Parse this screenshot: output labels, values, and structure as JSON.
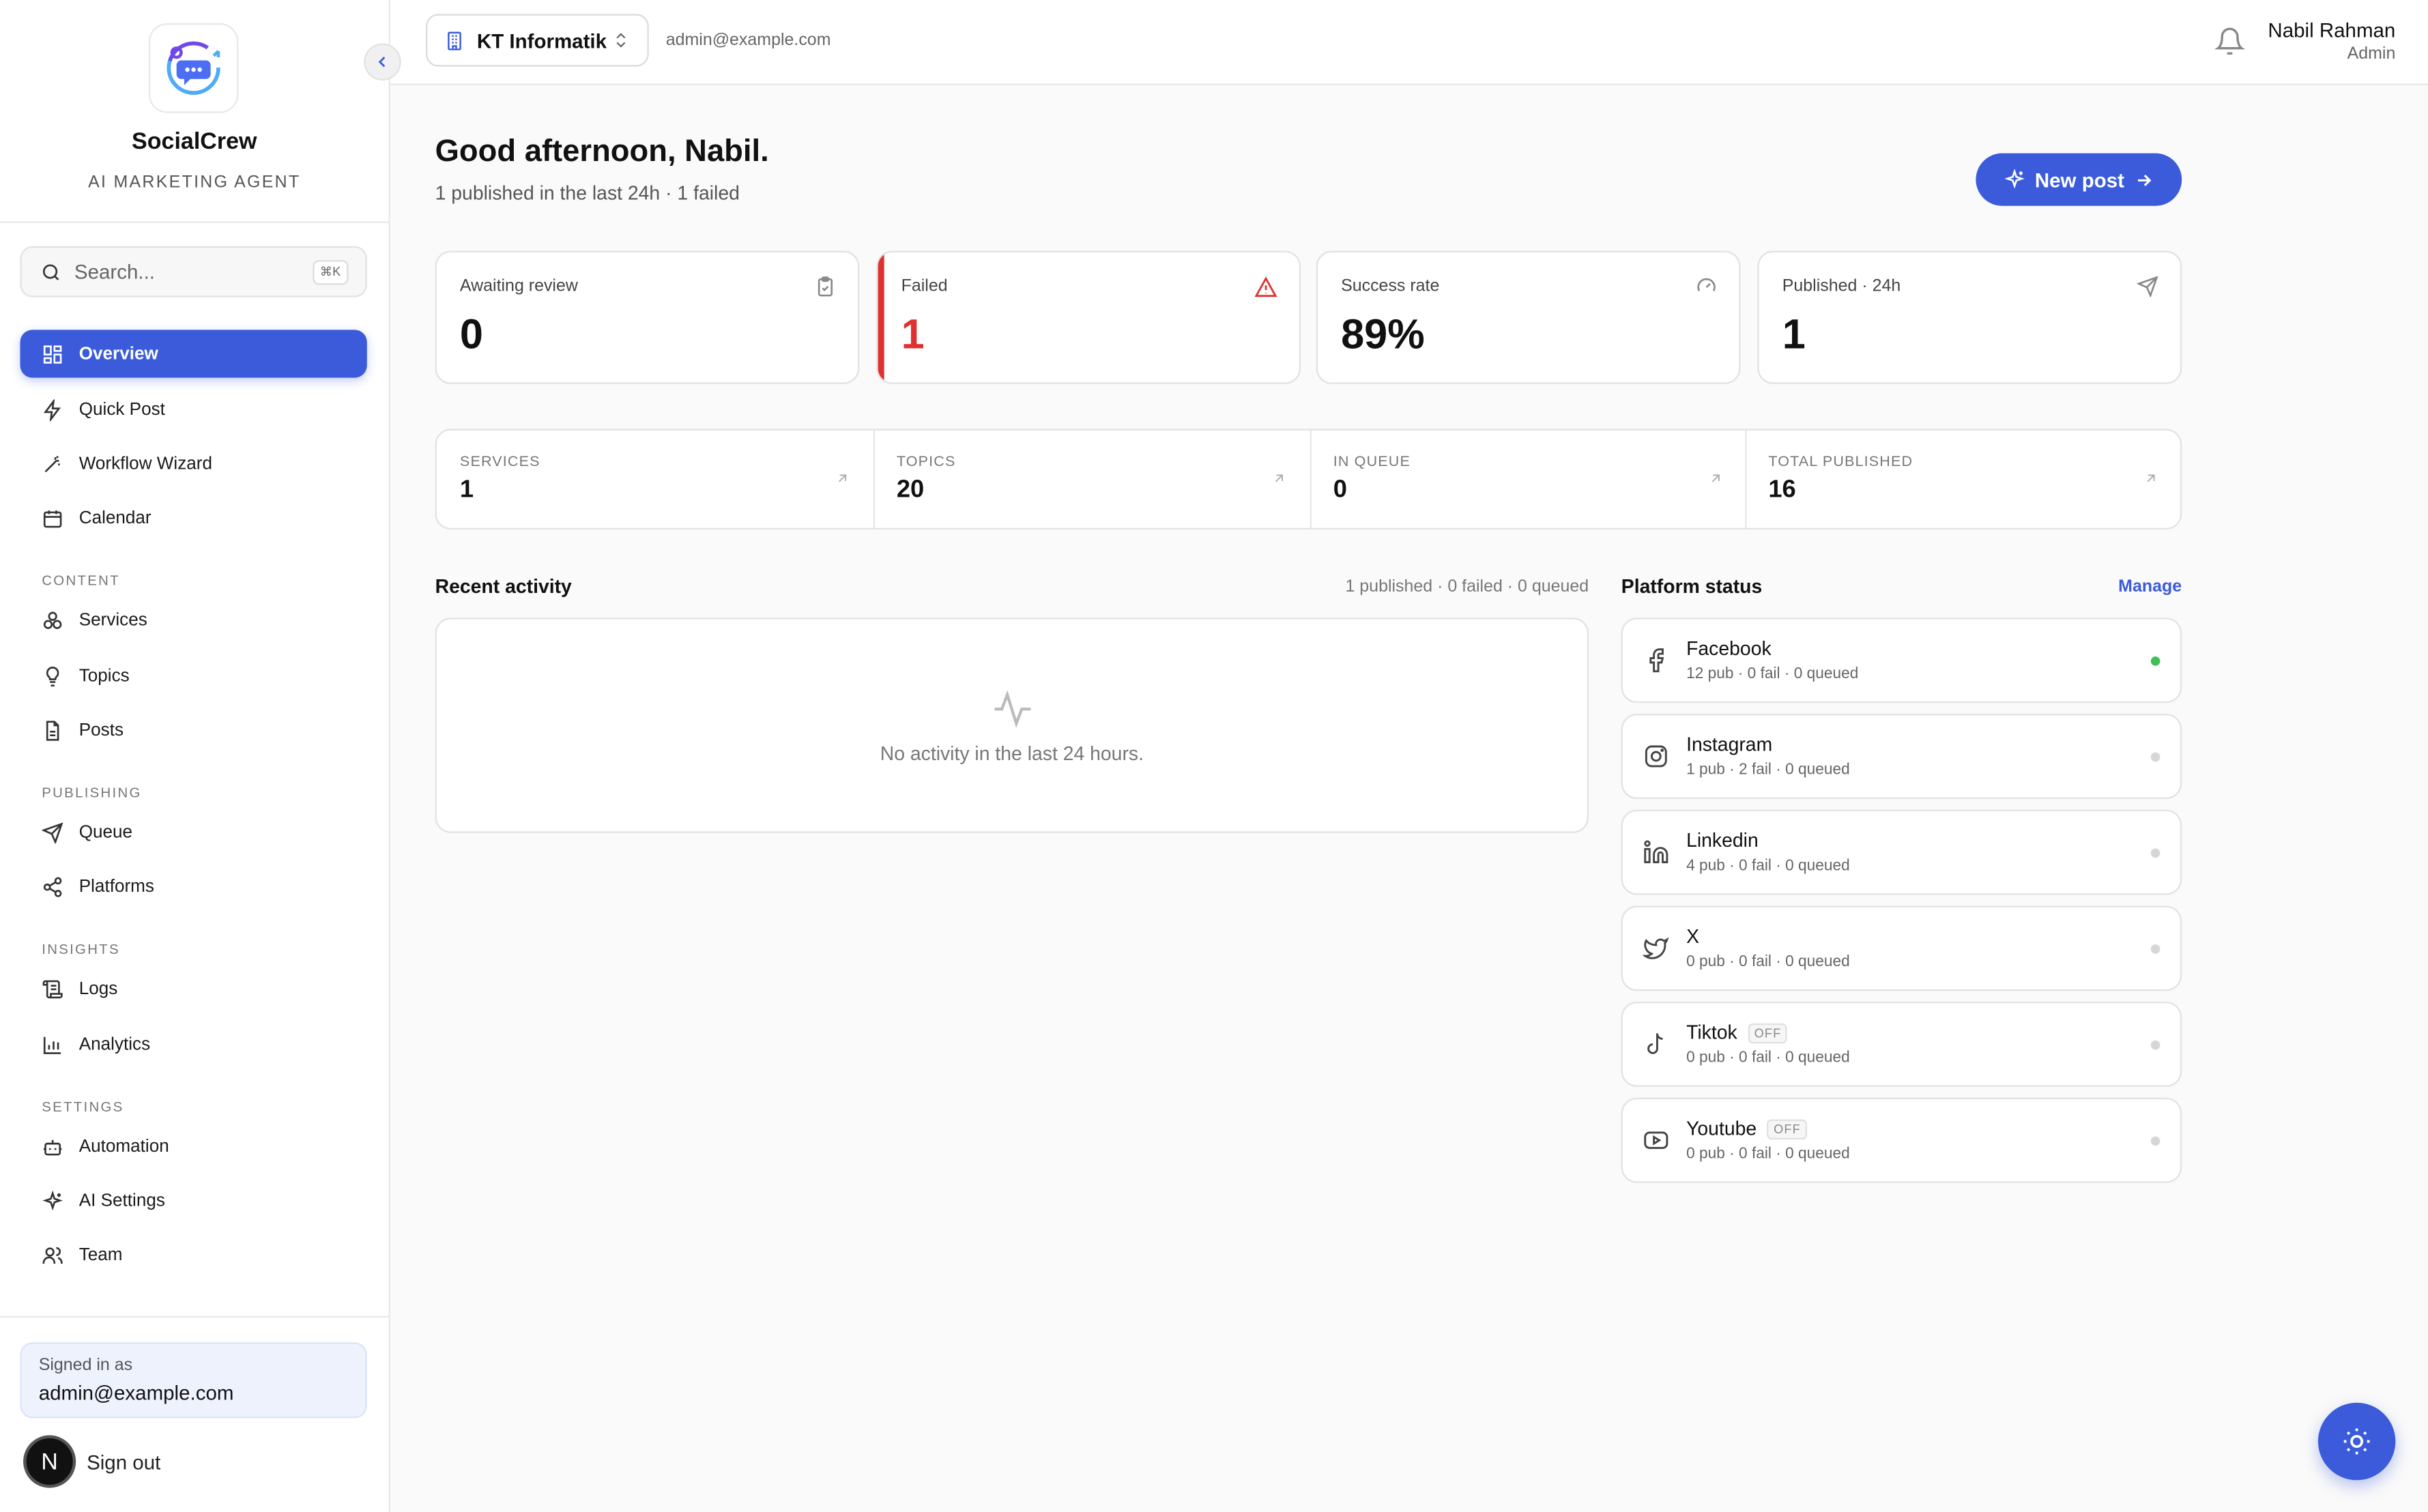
{
  "brand": {
    "name": "SocialCrew",
    "tagline": "AI MARKETING AGENT"
  },
  "search": {
    "placeholder": "Search...",
    "shortcut": "⌘K"
  },
  "nav": {
    "main": [
      {
        "label": "Overview",
        "icon": "grid-icon",
        "active": true
      },
      {
        "label": "Quick Post",
        "icon": "bolt-icon"
      },
      {
        "label": "Workflow Wizard",
        "icon": "magic-wand-icon"
      },
      {
        "label": "Calendar",
        "icon": "calendar-icon"
      }
    ],
    "content_title": "CONTENT",
    "content": [
      {
        "label": "Services",
        "icon": "services-icon"
      },
      {
        "label": "Topics",
        "icon": "lightbulb-icon"
      },
      {
        "label": "Posts",
        "icon": "document-icon"
      }
    ],
    "publishing_title": "PUBLISHING",
    "publishing": [
      {
        "label": "Queue",
        "icon": "send-icon"
      },
      {
        "label": "Platforms",
        "icon": "share-icon"
      }
    ],
    "insights_title": "INSIGHTS",
    "insights": [
      {
        "label": "Logs",
        "icon": "scroll-icon"
      },
      {
        "label": "Analytics",
        "icon": "bar-chart-icon"
      }
    ],
    "settings_title": "SETTINGS",
    "settings": [
      {
        "label": "Automation",
        "icon": "bot-icon"
      },
      {
        "label": "AI Settings",
        "icon": "sparkles-icon"
      },
      {
        "label": "Team",
        "icon": "users-icon"
      }
    ]
  },
  "account": {
    "signed_in_label": "Signed in as",
    "email": "admin@example.com",
    "avatar_letter": "N",
    "sign_out": "Sign out"
  },
  "topbar": {
    "workspace": "KT Informatik",
    "email": "admin@example.com",
    "user_name": "Nabil Rahman",
    "user_role": "Admin"
  },
  "header": {
    "greeting": "Good afternoon, Nabil.",
    "subtitle": "1 published in the last 24h · 1 failed",
    "new_post": "New post"
  },
  "stats": [
    {
      "label": "Awaiting review",
      "value": "0",
      "icon": "clipboard-check-icon"
    },
    {
      "label": "Failed",
      "value": "1",
      "icon": "alert-triangle-icon"
    },
    {
      "label": "Success rate",
      "value": "89%",
      "icon": "gauge-icon"
    },
    {
      "label": "Published · 24h",
      "value": "1",
      "icon": "send-icon"
    }
  ],
  "counters": [
    {
      "label": "SERVICES",
      "value": "1"
    },
    {
      "label": "TOPICS",
      "value": "20"
    },
    {
      "label": "IN QUEUE",
      "value": "0"
    },
    {
      "label": "TOTAL PUBLISHED",
      "value": "16"
    }
  ],
  "activity": {
    "title": "Recent activity",
    "meta": "1 published · 0 failed · 0 queued",
    "empty": "No activity in the last 24 hours."
  },
  "platforms": {
    "title": "Platform status",
    "manage": "Manage",
    "items": [
      {
        "name": "Facebook",
        "stats": "12 pub · 0 fail · 0 queued",
        "icon": "facebook-icon",
        "active": true
      },
      {
        "name": "Instagram",
        "stats": "1 pub · 2 fail · 0 queued",
        "icon": "instagram-icon"
      },
      {
        "name": "Linkedin",
        "stats": "4 pub · 0 fail · 0 queued",
        "icon": "linkedin-icon"
      },
      {
        "name": "X",
        "stats": "0 pub · 0 fail · 0 queued",
        "icon": "twitter-icon"
      },
      {
        "name": "Tiktok",
        "stats": "0 pub · 0 fail · 0 queued",
        "icon": "tiktok-icon",
        "badge": "OFF"
      },
      {
        "name": "Youtube",
        "stats": "0 pub · 0 fail · 0 queued",
        "icon": "youtube-icon",
        "badge": "OFF"
      }
    ]
  },
  "colors": {
    "accent": "#3b5bdb",
    "danger": "#e03131",
    "success": "#40c057"
  }
}
